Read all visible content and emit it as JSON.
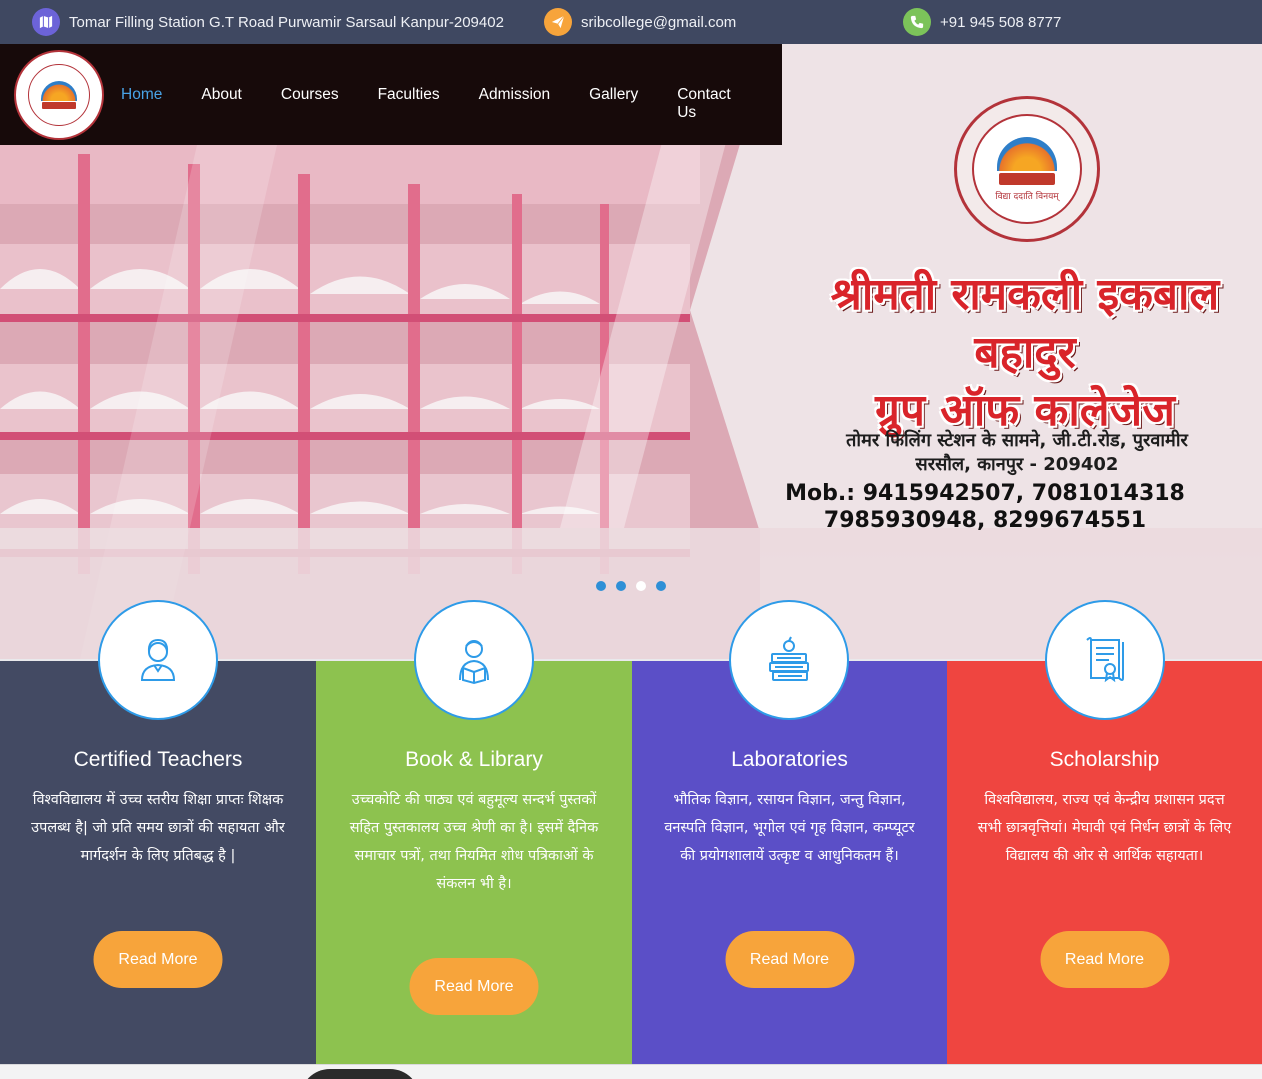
{
  "topbar": {
    "address": "Tomar Filling Station G.T Road Purwamir Sarsaul Kanpur-209402",
    "email": "sribcollege@gmail.com",
    "phone": "+91 945 508 8777",
    "colors": {
      "address_icon": "#6c63d8",
      "email_icon": "#f7a43b",
      "phone_icon": "#7cc35a"
    }
  },
  "nav": {
    "items": [
      "Home",
      "About",
      "Courses",
      "Faculties",
      "Admission",
      "Gallery",
      "Contact Us"
    ],
    "active": "Home"
  },
  "hero": {
    "title_line1": "श्रीमती रामकली इकबाल बहादुर",
    "title_line2": "ग्रुप ऑफ कालेजेज",
    "address_line1": "तोमर फिलिंग स्टेशन के सामने, जी.टी.रोड, पुरवामीर",
    "address_line2": "सरसौल, कानपुर - 209402",
    "mobile_line1": "Mob.: 9415942507, 7081014318",
    "mobile_line2": "7985930948, 8299674551",
    "emblem_motto": "विद्या ददाति विनयम्",
    "slide_count": 4,
    "active_slide": 3
  },
  "features": [
    {
      "title": "Certified Teachers",
      "text": "विश्वविद्यालय में उच्च स्तरीय शिक्षा प्राप्तः शिक्षक उपलब्ध है| जो प्रति समय छात्रों की सहायता और मार्गदर्शन के लिए प्रतिबद्ध है |",
      "button": "Read More",
      "icon": "teacher-icon",
      "color": "#434a63"
    },
    {
      "title": "Book & Library",
      "text": "उच्चकोटि की पाठ्य एवं बहुमूल्य सन्दर्भ पुस्तकों सहित पुस्तकालय उच्च श्रेणी का है। इसमें दैनिक समाचार पत्रों, तथा नियमित शोध पत्रिकाओं के संकलन भी है।",
      "button": "Read More",
      "icon": "reader-icon",
      "color": "#8dc24f"
    },
    {
      "title": "Laboratories",
      "text": "भौतिक विज्ञान, रसायन विज्ञान, जन्तु विज्ञान, वनस्पति विज्ञान, भूगोल एवं गृह विज्ञान, कम्प्यूटर की प्रयोगशालायें उत्कृष्ट व आधुनिकतम हैं।",
      "button": "Read More",
      "icon": "books-apple-icon",
      "color": "#5b4fc7"
    },
    {
      "title": "Scholarship",
      "text": "विश्वविद्यालय, राज्य एवं केन्द्रीय प्रशासन प्रदत्त सभी छात्रवृत्तियां। मेघावी एवं निर्धन छात्रों के लिए विद्यालय की ओर से आर्थिक सहायता।",
      "button": "Read More",
      "icon": "certificate-icon",
      "color": "#ef4540"
    }
  ],
  "colors": {
    "accent": "#49a3e6",
    "button": "#f7a43b",
    "icon_blue": "#2e9be8"
  }
}
